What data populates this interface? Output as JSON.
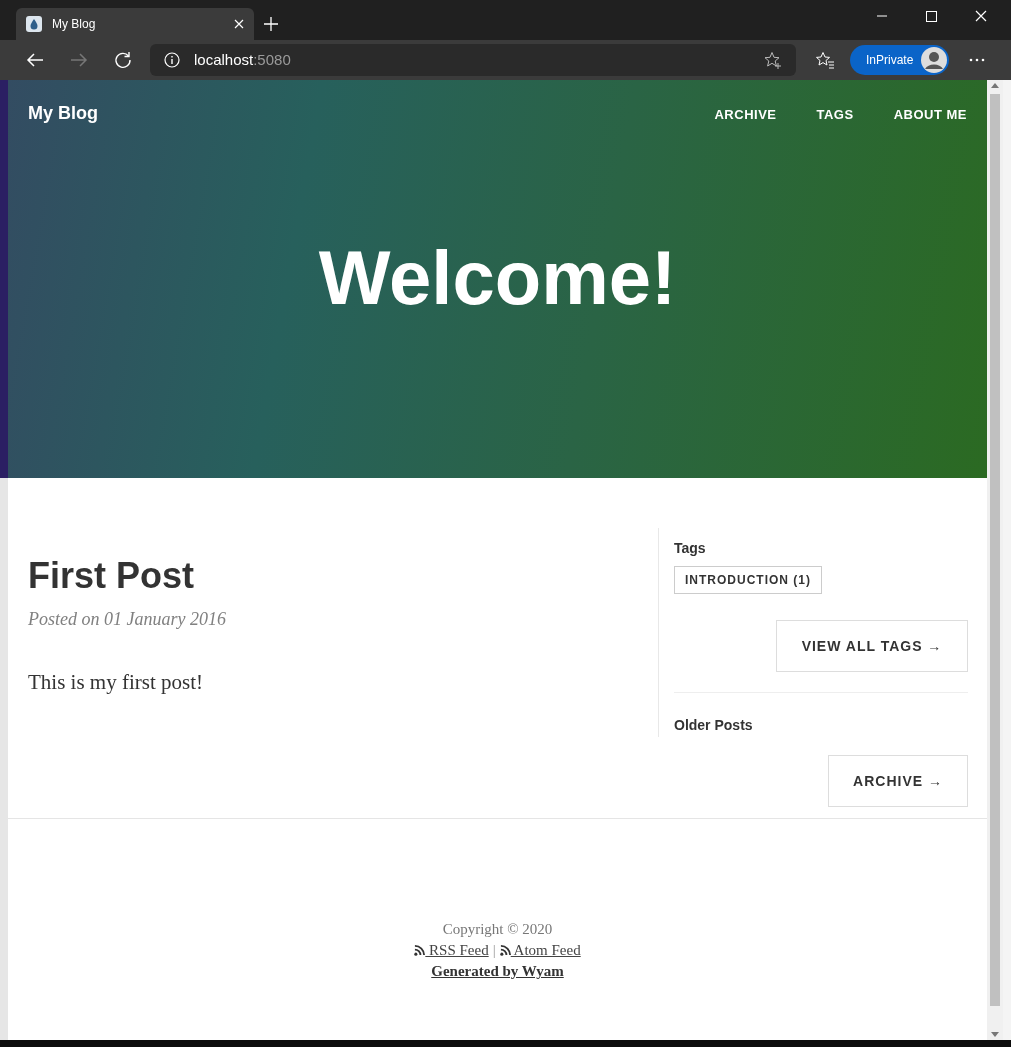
{
  "browser": {
    "tab_title": "My Blog",
    "address_host": "localhost",
    "address_port": ":5080",
    "profile_label": "InPrivate"
  },
  "site": {
    "brand": "My Blog",
    "nav": [
      "ARCHIVE",
      "TAGS",
      "ABOUT ME"
    ],
    "hero_title": "Welcome!"
  },
  "post": {
    "title": "First Post",
    "meta": "Posted on 01 January 2016",
    "body": "This is my first post!"
  },
  "sidebar": {
    "tags_heading": "Tags",
    "tags": [
      "INTRODUCTION (1)"
    ],
    "view_all_button": "VIEW ALL TAGS →",
    "older_heading": "Older Posts",
    "archive_button": "ARCHIVE →"
  },
  "footer": {
    "copyright": "Copyright © 2020",
    "links": [
      "RSS Feed",
      "Atom Feed"
    ],
    "separator": "|",
    "generator": "Generated by Wyam"
  }
}
